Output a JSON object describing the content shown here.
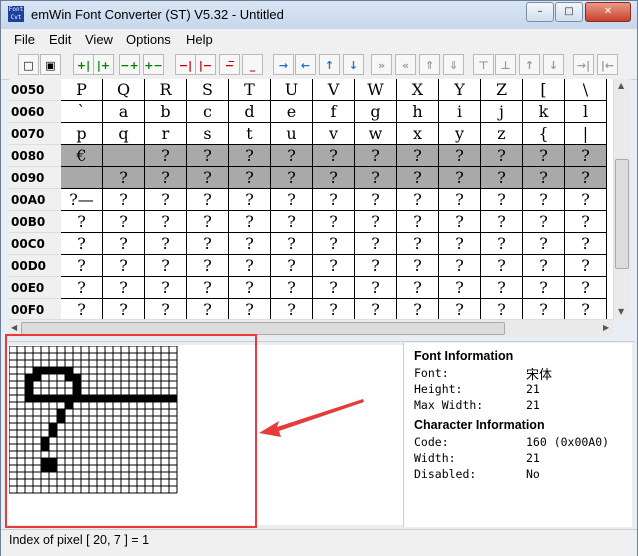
{
  "window": {
    "title": "emWin Font Converter (ST) V5.32 - Untitled",
    "icon_text": "Font Cvt",
    "min_glyph": "–",
    "max_glyph": "□",
    "close_glyph": "✕"
  },
  "menu": [
    "File",
    "Edit",
    "View",
    "Options",
    "Help"
  ],
  "toolbar": [
    {
      "icon": "new-file",
      "glyph": "□",
      "color": "black"
    },
    {
      "icon": "save",
      "glyph": "▣",
      "color": "black"
    },
    {
      "icon": "insert-left-column",
      "glyph": "+|",
      "color": "green"
    },
    {
      "icon": "insert-right-column",
      "glyph": "|+",
      "color": "green"
    },
    {
      "icon": "insert-top-row",
      "glyph": "−+",
      "color": "green"
    },
    {
      "icon": "insert-bottom-row",
      "glyph": "+−",
      "color": "green"
    },
    {
      "icon": "delete-left-column",
      "glyph": "−|",
      "color": "red"
    },
    {
      "icon": "delete-right-column",
      "glyph": "|−",
      "color": "red"
    },
    {
      "icon": "delete-top-row",
      "glyph": "−̅",
      "color": "red"
    },
    {
      "icon": "delete-bottom-row",
      "glyph": "_",
      "color": "red"
    },
    {
      "icon": "move-right",
      "glyph": "→",
      "color": "blue"
    },
    {
      "icon": "move-left",
      "glyph": "←",
      "color": "blue"
    },
    {
      "icon": "move-up",
      "glyph": "↑",
      "color": "blue"
    },
    {
      "icon": "move-down",
      "glyph": "↓",
      "color": "blue"
    },
    {
      "icon": "all-right",
      "glyph": "»",
      "color": "gray"
    },
    {
      "icon": "all-left",
      "glyph": "«",
      "color": "gray"
    },
    {
      "icon": "all-up",
      "glyph": "⇑",
      "color": "gray"
    },
    {
      "icon": "all-down",
      "glyph": "⇓",
      "color": "gray"
    },
    {
      "icon": "align-top",
      "glyph": "⊤",
      "color": "gray"
    },
    {
      "icon": "align-bottom",
      "glyph": "⊥",
      "color": "gray"
    },
    {
      "icon": "align-up",
      "glyph": "↑",
      "color": "gray"
    },
    {
      "icon": "align-down",
      "glyph": "↓",
      "color": "gray"
    },
    {
      "icon": "align-right",
      "glyph": "→|",
      "color": "gray"
    },
    {
      "icon": "align-left",
      "glyph": "|←",
      "color": "gray"
    }
  ],
  "char_table": {
    "rows": [
      {
        "code": "0050",
        "chars": [
          "P",
          "Q",
          "R",
          "S",
          "T",
          "U",
          "V",
          "W",
          "X",
          "Y",
          "Z",
          "[",
          "\\"
        ],
        "gray": false
      },
      {
        "code": "0060",
        "chars": [
          "`",
          "a",
          "b",
          "c",
          "d",
          "e",
          "f",
          "g",
          "h",
          "i",
          "j",
          "k",
          "l"
        ],
        "gray": false
      },
      {
        "code": "0070",
        "chars": [
          "p",
          "q",
          "r",
          "s",
          "t",
          "u",
          "v",
          "w",
          "x",
          "y",
          "z",
          "{",
          "|"
        ],
        "gray": false
      },
      {
        "code": "0080",
        "chars": [
          "€",
          "",
          "?",
          "?",
          "?",
          "?",
          "?",
          "?",
          "?",
          "?",
          "?",
          "?",
          "?"
        ],
        "gray": true
      },
      {
        "code": "0090",
        "chars": [
          "",
          "?",
          "?",
          "?",
          "?",
          "?",
          "?",
          "?",
          "?",
          "?",
          "?",
          "?",
          "?"
        ],
        "gray": true
      },
      {
        "code": "00A0",
        "chars": [
          "?—",
          "?",
          "?",
          "?",
          "?",
          "?",
          "?",
          "?",
          "?",
          "?",
          "?",
          "?",
          "?"
        ],
        "gray": false
      },
      {
        "code": "00B0",
        "chars": [
          "?",
          "?",
          "?",
          "?",
          "?",
          "?",
          "?",
          "?",
          "?",
          "?",
          "?",
          "?",
          "?"
        ],
        "gray": false
      },
      {
        "code": "00C0",
        "chars": [
          "?",
          "?",
          "?",
          "?",
          "?",
          "?",
          "?",
          "?",
          "?",
          "?",
          "?",
          "?",
          "?"
        ],
        "gray": false
      },
      {
        "code": "00D0",
        "chars": [
          "?",
          "?",
          "?",
          "?",
          "?",
          "?",
          "?",
          "?",
          "?",
          "?",
          "?",
          "?",
          "?"
        ],
        "gray": false
      },
      {
        "code": "00E0",
        "chars": [
          "?",
          "?",
          "?",
          "?",
          "?",
          "?",
          "?",
          "?",
          "?",
          "?",
          "?",
          "?",
          "?"
        ],
        "gray": false
      },
      {
        "code": "00F0",
        "chars": [
          "?",
          "?",
          "?",
          "?",
          "?",
          "?",
          "?",
          "?",
          "?",
          "?",
          "?",
          "?",
          "?"
        ],
        "gray": false
      }
    ]
  },
  "pixel_editor": {
    "columns": 21,
    "rows": 21,
    "filled": [
      [
        3,
        3
      ],
      [
        4,
        3
      ],
      [
        5,
        3
      ],
      [
        6,
        3
      ],
      [
        7,
        3
      ],
      [
        2,
        4
      ],
      [
        3,
        4
      ],
      [
        7,
        4
      ],
      [
        8,
        4
      ],
      [
        2,
        5
      ],
      [
        8,
        5
      ],
      [
        2,
        6
      ],
      [
        8,
        6
      ],
      [
        2,
        7
      ],
      [
        3,
        7
      ],
      [
        4,
        7
      ],
      [
        5,
        7
      ],
      [
        6,
        7
      ],
      [
        7,
        7
      ],
      [
        8,
        7
      ],
      [
        9,
        7
      ],
      [
        10,
        7
      ],
      [
        11,
        7
      ],
      [
        12,
        7
      ],
      [
        13,
        7
      ],
      [
        14,
        7
      ],
      [
        15,
        7
      ],
      [
        16,
        7
      ],
      [
        17,
        7
      ],
      [
        18,
        7
      ],
      [
        19,
        7
      ],
      [
        20,
        7
      ],
      [
        7,
        8
      ],
      [
        6,
        9
      ],
      [
        6,
        10
      ],
      [
        5,
        11
      ],
      [
        5,
        12
      ],
      [
        4,
        13
      ],
      [
        4,
        14
      ],
      [
        4,
        16
      ],
      [
        5,
        16
      ],
      [
        4,
        17
      ],
      [
        5,
        17
      ]
    ]
  },
  "font_info": {
    "heading": "Font Information",
    "fields": [
      {
        "key": "Font:",
        "value": "宋体"
      },
      {
        "key": "Height:",
        "value": "21"
      },
      {
        "key": "Max Width:",
        "value": "21"
      }
    ]
  },
  "char_info": {
    "heading": "Character Information",
    "fields": [
      {
        "key": "Code:",
        "value": "160  (0x00A0)"
      },
      {
        "key": "Width:",
        "value": "21"
      },
      {
        "key": "Disabled:",
        "value": "No"
      }
    ]
  },
  "status": {
    "text": "Index of pixel [ 20, 7 ] = 1"
  },
  "colors": {
    "highlight": "#e53b3b",
    "gray_row": "#a9a9a9"
  }
}
